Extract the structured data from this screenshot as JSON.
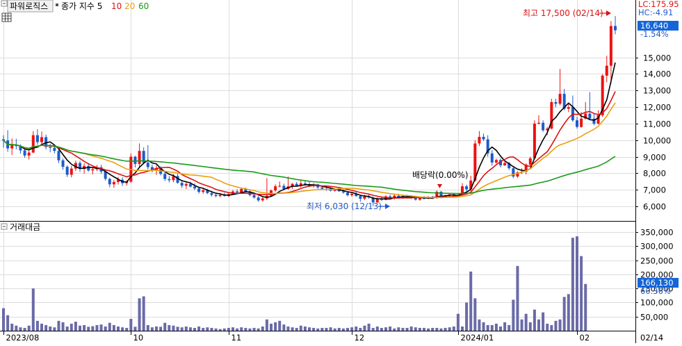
{
  "header": {
    "stock_name": "파워로직스",
    "ma_label": "종가 지수 5",
    "ma_periods": [
      "10",
      "20",
      "60"
    ]
  },
  "volume_header": {
    "label": "거래대금"
  },
  "right_axis": {
    "lc_label": "LC:175.95",
    "hc_label": "HC:-4.91",
    "current_price_label": "16,640",
    "change_label": "-1.54%",
    "current_volume_label": "166,130",
    "volume_pct_label": "60.36%"
  },
  "annotations": {
    "high": "최고 17,500 (02/14)",
    "low": "최저 6,030 (12/13)",
    "dividend": "배당락(0.00%)"
  },
  "colors": {
    "up": "#ee1111",
    "down": "#1f5bc9",
    "ma5": "#000000",
    "ma10": "#dd1111",
    "ma20": "#e8a010",
    "ma60": "#1a9a1a",
    "volume": "#6a6aa8",
    "current_badge": "#1565d8"
  },
  "chart_data": [
    {
      "type": "candlestick",
      "title": "",
      "price_ticks": [
        6000,
        7000,
        8000,
        9000,
        10000,
        11000,
        12000,
        13000,
        14000,
        15000
      ],
      "ylim": [
        5200,
        17800
      ],
      "x_ticks": [
        {
          "label": "2023/08",
          "index": 0
        },
        {
          "label": "10",
          "index": 30
        },
        {
          "label": "11",
          "index": 53
        },
        {
          "label": "12",
          "index": 82
        },
        {
          "label": "2024/01",
          "index": 107
        },
        {
          "label": "02",
          "index": 135
        },
        {
          "label": "02/14",
          "index": 151
        }
      ],
      "candles": [
        [
          10050,
          10300,
          9550,
          9980
        ],
        [
          9980,
          10600,
          9300,
          9500
        ],
        [
          9500,
          10100,
          9100,
          9720
        ],
        [
          9720,
          10080,
          9440,
          9640
        ],
        [
          9640,
          9750,
          9180,
          9380
        ],
        [
          9380,
          9450,
          8940,
          9070
        ],
        [
          9070,
          9380,
          8830,
          9250
        ],
        [
          9250,
          10550,
          9220,
          10300
        ],
        [
          10300,
          10660,
          9720,
          9880
        ],
        [
          9880,
          10520,
          9700,
          10180
        ],
        [
          10180,
          10330,
          9440,
          9590
        ],
        [
          9590,
          9780,
          9270,
          9530
        ],
        [
          9530,
          9740,
          9200,
          9350
        ],
        [
          9350,
          9560,
          8610,
          8780
        ],
        [
          8780,
          8890,
          8210,
          8390
        ],
        [
          8390,
          8480,
          7770,
          7910
        ],
        [
          7910,
          8440,
          7750,
          8280
        ],
        [
          8280,
          8760,
          8140,
          8620
        ],
        [
          8620,
          8750,
          8080,
          8260
        ],
        [
          8260,
          8600,
          7980,
          8440
        ],
        [
          8440,
          8600,
          8090,
          8170
        ],
        [
          8170,
          8340,
          7930,
          8240
        ],
        [
          8240,
          8500,
          8130,
          8360
        ],
        [
          8360,
          8510,
          7960,
          8100
        ],
        [
          8100,
          8200,
          7550,
          7660
        ],
        [
          7660,
          7730,
          7150,
          7330
        ],
        [
          7330,
          7590,
          7120,
          7470
        ],
        [
          7470,
          7780,
          7320,
          7610
        ],
        [
          7610,
          7760,
          7230,
          7400
        ],
        [
          7400,
          7580,
          7250,
          7490
        ],
        [
          7490,
          9200,
          7410,
          9000
        ],
        [
          9000,
          9050,
          8350,
          8560
        ],
        [
          8560,
          9800,
          8300,
          9350
        ],
        [
          9350,
          9560,
          8540,
          8640
        ],
        [
          8640,
          9700,
          8230,
          8370
        ],
        [
          8370,
          8530,
          8050,
          8190
        ],
        [
          8190,
          8480,
          7910,
          8300
        ],
        [
          8300,
          8420,
          7870,
          7960
        ],
        [
          7960,
          8080,
          7530,
          7650
        ],
        [
          7650,
          7830,
          7440,
          7580
        ],
        [
          7580,
          7950,
          7450,
          7830
        ],
        [
          7830,
          7960,
          7360,
          7420
        ],
        [
          7420,
          7540,
          7110,
          7250
        ],
        [
          7250,
          7480,
          7050,
          7350
        ],
        [
          7350,
          7490,
          7140,
          7190
        ],
        [
          7190,
          7390,
          6980,
          7080
        ],
        [
          7080,
          7180,
          6770,
          6870
        ],
        [
          6870,
          7070,
          6760,
          6970
        ],
        [
          6970,
          7060,
          6730,
          6800
        ],
        [
          6800,
          6930,
          6590,
          6690
        ],
        [
          6690,
          6800,
          6550,
          6620
        ],
        [
          6620,
          6760,
          6540,
          6700
        ],
        [
          6700,
          6820,
          6580,
          6620
        ],
        [
          6620,
          6800,
          6560,
          6740
        ],
        [
          6740,
          6990,
          6680,
          6900
        ],
        [
          6900,
          7030,
          6780,
          6830
        ],
        [
          6830,
          7120,
          6770,
          7050
        ],
        [
          7050,
          7130,
          6840,
          6890
        ],
        [
          6890,
          7000,
          6600,
          6680
        ],
        [
          6680,
          6770,
          6470,
          6530
        ],
        [
          6530,
          6650,
          6270,
          6360
        ],
        [
          6360,
          6560,
          6280,
          6480
        ],
        [
          6480,
          7700,
          6380,
          6640
        ],
        [
          6640,
          7010,
          6610,
          6960
        ],
        [
          6960,
          7330,
          6870,
          7210
        ],
        [
          7210,
          7500,
          7140,
          7240
        ],
        [
          7240,
          7370,
          6980,
          7050
        ],
        [
          7050,
          7800,
          7000,
          7200
        ],
        [
          7200,
          7410,
          7050,
          7360
        ],
        [
          7360,
          7470,
          7190,
          7260
        ],
        [
          7260,
          7570,
          7140,
          7390
        ],
        [
          7390,
          7550,
          7250,
          7310
        ],
        [
          7310,
          7470,
          7160,
          7230
        ],
        [
          7230,
          7400,
          7120,
          7320
        ],
        [
          7320,
          7360,
          7050,
          7140
        ],
        [
          7140,
          7240,
          6990,
          7060
        ],
        [
          7060,
          7160,
          6940,
          7030
        ],
        [
          7030,
          7160,
          6900,
          6940
        ],
        [
          6940,
          7090,
          6890,
          7040
        ],
        [
          7040,
          7100,
          6880,
          6910
        ],
        [
          6910,
          7030,
          6760,
          6830
        ],
        [
          6830,
          6920,
          6600,
          6670
        ],
        [
          6670,
          6830,
          6580,
          6760
        ],
        [
          6760,
          6870,
          6570,
          6620
        ],
        [
          6620,
          6690,
          6280,
          6460
        ],
        [
          6460,
          6700,
          6380,
          6600
        ],
        [
          6600,
          6710,
          6460,
          6530
        ],
        [
          6530,
          6600,
          6030,
          6240
        ],
        [
          6240,
          6550,
          6190,
          6480
        ],
        [
          6480,
          6600,
          6310,
          6390
        ],
        [
          6390,
          6670,
          6360,
          6600
        ],
        [
          6600,
          6700,
          6420,
          6480
        ],
        [
          6480,
          6720,
          6400,
          6640
        ],
        [
          6640,
          6760,
          6500,
          6560
        ],
        [
          6560,
          6690,
          6450,
          6620
        ],
        [
          6620,
          6700,
          6490,
          6540
        ],
        [
          6540,
          6670,
          6440,
          6590
        ],
        [
          6590,
          6640,
          6350,
          6400
        ],
        [
          6400,
          6560,
          6330,
          6500
        ],
        [
          6500,
          6620,
          6420,
          6470
        ],
        [
          6470,
          6620,
          6430,
          6560
        ],
        [
          6560,
          6640,
          6450,
          6500
        ],
        [
          6500,
          6960,
          6460,
          6880
        ],
        [
          6880,
          6930,
          6480,
          6590
        ],
        [
          6590,
          6700,
          6550,
          6650
        ],
        [
          6650,
          6760,
          6590,
          6720
        ],
        [
          6720,
          6810,
          6560,
          6620
        ],
        [
          6620,
          6740,
          6560,
          6690
        ],
        [
          6690,
          7400,
          6640,
          7210
        ],
        [
          7210,
          7310,
          6890,
          7030
        ],
        [
          7030,
          7850,
          6920,
          7560
        ],
        [
          7560,
          10000,
          7480,
          9800
        ],
        [
          9800,
          10550,
          9650,
          10200
        ],
        [
          10200,
          10400,
          9950,
          10050
        ],
        [
          10050,
          10300,
          9000,
          9200
        ],
        [
          9200,
          9400,
          8450,
          8650
        ],
        [
          8650,
          8880,
          8580,
          8800
        ],
        [
          8800,
          8900,
          8350,
          8480
        ],
        [
          8480,
          8700,
          8440,
          8620
        ],
        [
          8620,
          8680,
          8200,
          8300
        ],
        [
          8300,
          8350,
          7700,
          7800
        ],
        [
          7800,
          8120,
          7730,
          8050
        ],
        [
          8050,
          8300,
          7950,
          8100
        ],
        [
          8100,
          8600,
          7930,
          8520
        ],
        [
          8520,
          9000,
          8410,
          8900
        ],
        [
          8900,
          11200,
          8850,
          11000
        ],
        [
          11000,
          11500,
          10950,
          11050
        ],
        [
          11050,
          11200,
          10500,
          10600
        ],
        [
          10600,
          10800,
          10300,
          10700
        ],
        [
          10700,
          12500,
          10650,
          12300
        ],
        [
          12300,
          12500,
          12000,
          12200
        ],
        [
          12200,
          14300,
          12100,
          12800
        ],
        [
          12800,
          13100,
          11800,
          11900
        ],
        [
          11900,
          12200,
          11700,
          12000
        ],
        [
          12000,
          12700,
          11100,
          11200
        ],
        [
          11200,
          11400,
          10700,
          10800
        ],
        [
          10800,
          11700,
          10750,
          11300
        ],
        [
          11300,
          12300,
          11250,
          11600
        ],
        [
          11600,
          12900,
          11250,
          11300
        ],
        [
          11300,
          11600,
          10900,
          11000
        ],
        [
          11000,
          11800,
          10950,
          11500
        ],
        [
          11500,
          14000,
          11400,
          13900
        ],
        [
          13900,
          15100,
          13500,
          14500
        ],
        [
          14500,
          17200,
          13400,
          16900
        ],
        [
          16900,
          17500,
          16400,
          16640
        ]
      ],
      "ma_lines": [
        {
          "name": "5",
          "period": 5,
          "color": "#000000"
        },
        {
          "name": "10",
          "period": 10,
          "color": "#dd1111"
        },
        {
          "name": "20",
          "period": 20,
          "color": "#e8a010"
        },
        {
          "name": "60",
          "period": 60,
          "color": "#1a9a1a"
        }
      ]
    },
    {
      "type": "bar",
      "title": "",
      "y_ticks": [
        50000,
        100000,
        150000,
        200000,
        250000,
        300000,
        350000
      ],
      "ylim": [
        0,
        370000
      ],
      "values": [
        80000,
        55000,
        25000,
        18000,
        12000,
        10000,
        18000,
        150000,
        35000,
        25000,
        20000,
        15000,
        12000,
        35000,
        30000,
        15000,
        25000,
        32000,
        18000,
        20000,
        14000,
        16000,
        20000,
        22000,
        15000,
        28000,
        20000,
        15000,
        12000,
        10000,
        42000,
        14000,
        115000,
        122000,
        20000,
        12000,
        15000,
        14000,
        28000,
        20000,
        18000,
        14000,
        12000,
        15000,
        12000,
        10000,
        15000,
        10000,
        12000,
        10000,
        8000,
        6000,
        8000,
        10000,
        12000,
        8000,
        12000,
        10000,
        8000,
        10000,
        8000,
        15000,
        40000,
        25000,
        30000,
        35000,
        22000,
        15000,
        12000,
        10000,
        18000,
        15000,
        12000,
        10000,
        8000,
        10000,
        10000,
        12000,
        8000,
        10000,
        8000,
        10000,
        12000,
        15000,
        10000,
        18000,
        25000,
        10000,
        15000,
        10000,
        12000,
        15000,
        8000,
        12000,
        10000,
        10000,
        15000,
        12000,
        10000,
        10000,
        8000,
        10000,
        10000,
        8000,
        10000,
        12000,
        15000,
        60000,
        15000,
        100000,
        210000,
        115000,
        40000,
        30000,
        20000,
        20000,
        25000,
        15000,
        30000,
        20000,
        110000,
        230000,
        40000,
        60000,
        30000,
        75000,
        40000,
        65000,
        25000,
        20000,
        35000,
        40000,
        120000,
        130000,
        330000,
        335000,
        265000,
        166130
      ]
    }
  ]
}
